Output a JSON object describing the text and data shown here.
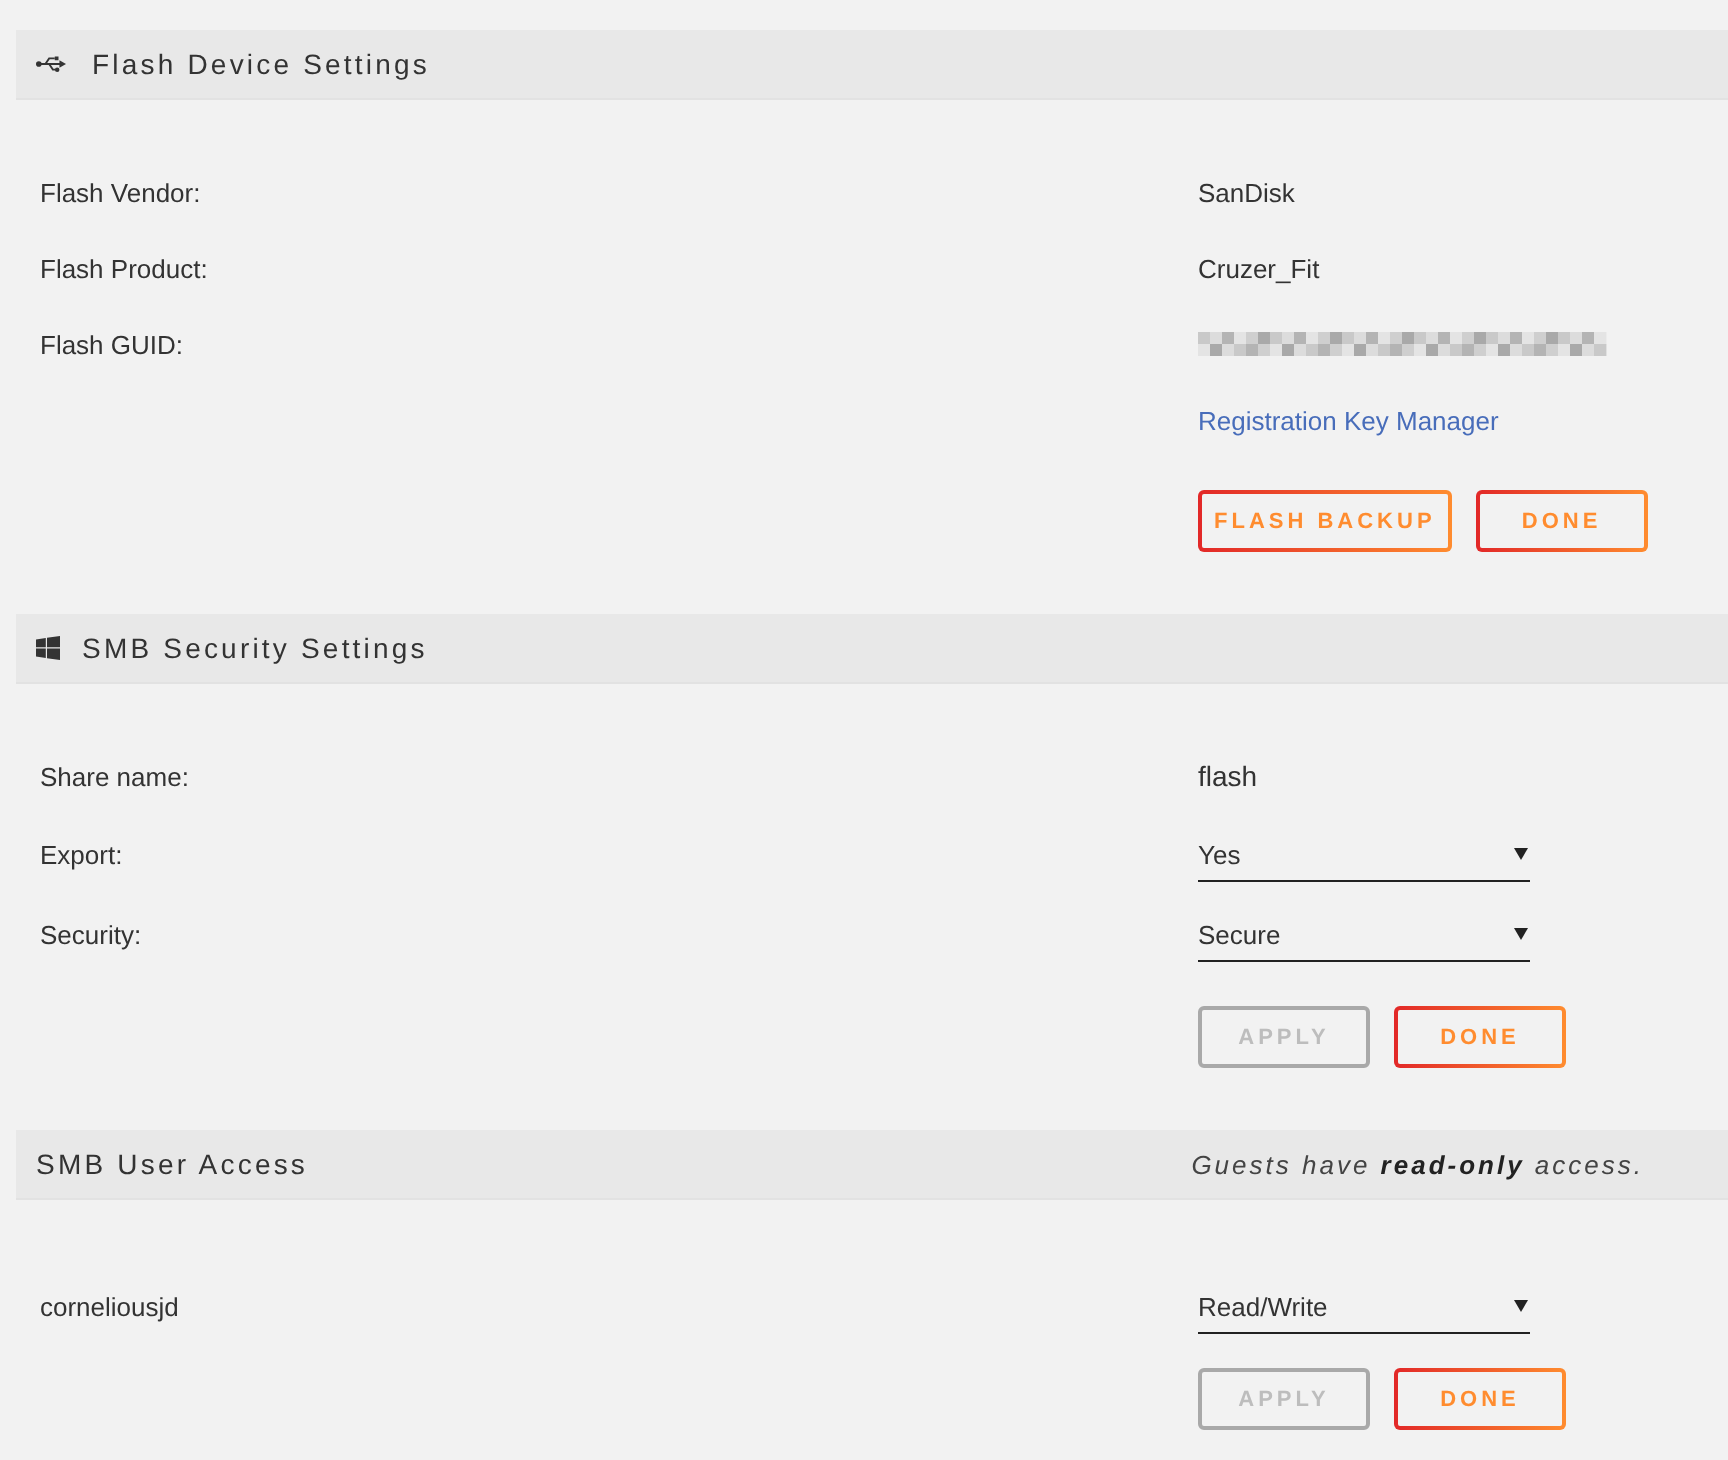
{
  "sections": [
    {
      "title": "Flash Device Settings",
      "rows": [
        {
          "kind": "text",
          "label": "Flash Vendor:",
          "value": "SanDisk"
        },
        {
          "kind": "text",
          "label": "Flash Product:",
          "value": "Cruzer_Fit"
        },
        {
          "kind": "redacted",
          "label": "Flash GUID:"
        },
        {
          "kind": "link",
          "value": "Registration Key Manager"
        }
      ],
      "buttons": [
        {
          "label": "FLASH BACKUP",
          "disabled": false
        },
        {
          "label": "DONE",
          "disabled": false
        }
      ]
    },
    {
      "title": "SMB Security Settings",
      "rows": [
        {
          "kind": "text",
          "label": "Share name:",
          "value": "flash"
        },
        {
          "kind": "select",
          "label": "Export:",
          "value": "Yes"
        },
        {
          "kind": "select",
          "label": "Security:",
          "value": "Secure"
        }
      ],
      "buttons": [
        {
          "label": "APPLY",
          "disabled": true
        },
        {
          "label": "DONE",
          "disabled": false
        }
      ]
    },
    {
      "title": "SMB User Access",
      "note": "Guests have **read-only** access.",
      "rows": [
        {
          "kind": "select",
          "label": "corneliousjd",
          "value": "Read/Write"
        }
      ],
      "buttons": [
        {
          "label": "APPLY",
          "disabled": true
        },
        {
          "label": "DONE",
          "disabled": false
        }
      ]
    }
  ]
}
